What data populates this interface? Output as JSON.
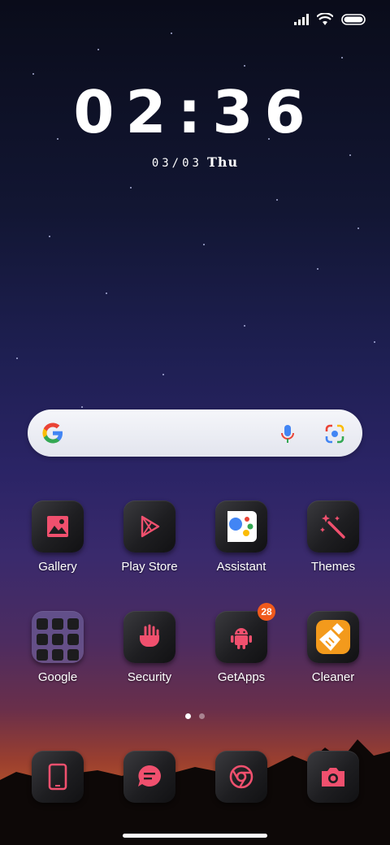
{
  "status_bar": {
    "icons": [
      "signal-icon",
      "wifi-icon",
      "battery-icon"
    ]
  },
  "clock": {
    "time": "02:36",
    "date": "03/03",
    "weekday": "Thu"
  },
  "search_widget": {
    "icons": [
      "google-logo-icon",
      "microphone-icon",
      "camera-lens-icon"
    ]
  },
  "apps_row1": [
    {
      "label": "Gallery",
      "icon": "image-icon"
    },
    {
      "label": "Play Store",
      "icon": "play-icon"
    },
    {
      "label": "Assistant",
      "icon": "assistant-icon"
    },
    {
      "label": "Themes",
      "icon": "magic-wand-icon"
    }
  ],
  "apps_row2": [
    {
      "label": "Google",
      "icon": "folder-icon"
    },
    {
      "label": "Security",
      "icon": "shield-icon"
    },
    {
      "label": "GetApps",
      "icon": "android-icon",
      "badge": "28"
    },
    {
      "label": "Cleaner",
      "icon": "broom-icon"
    }
  ],
  "page_indicator": {
    "pages": 2,
    "current": 1
  },
  "dock": [
    {
      "icon": "phone-icon"
    },
    {
      "icon": "message-icon"
    },
    {
      "icon": "chrome-icon"
    },
    {
      "icon": "camera-icon"
    }
  ],
  "colors": {
    "accent": "#f0506e",
    "badge": "#f05a1c",
    "cleaner_orange": "#f39a1c"
  }
}
